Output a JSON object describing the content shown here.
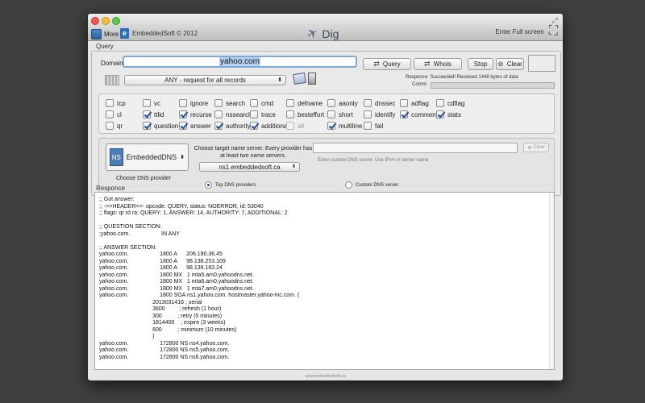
{
  "titlebar": {
    "more_label": "More",
    "brand_label": "EmbeddedSoft © 2012",
    "app_title": "Dig",
    "fullscreen_label": "Enter Full screen"
  },
  "query": {
    "section_label": "Query",
    "domain_label": "Domain",
    "domain_value": "yahoo.com",
    "query_button": "Query",
    "whois_button": "Whois",
    "stop_button": "Stop",
    "clear_button": "Clear",
    "response_status": "Responce:  Succeeded! Received 1448 bytes of data",
    "comm_label": "Comm:",
    "record_type": "ANY - request for all records"
  },
  "flags": [
    {
      "label": "tcp",
      "checked": false,
      "disabled": false
    },
    {
      "label": "vc",
      "checked": false,
      "disabled": false
    },
    {
      "label": "ignore",
      "checked": false,
      "disabled": false
    },
    {
      "label": "search",
      "checked": false,
      "disabled": false
    },
    {
      "label": "cmd",
      "checked": false,
      "disabled": false
    },
    {
      "label": "defname",
      "checked": false,
      "disabled": false
    },
    {
      "label": "aaonly",
      "checked": false,
      "disabled": false
    },
    {
      "label": "dnssec",
      "checked": false,
      "disabled": false
    },
    {
      "label": "adflag",
      "checked": false,
      "disabled": false
    },
    {
      "label": "cdflag",
      "checked": false,
      "disabled": false
    },
    {
      "label": "cl",
      "checked": false,
      "disabled": false
    },
    {
      "label": "ttlid",
      "checked": true,
      "disabled": false
    },
    {
      "label": "recurse",
      "checked": true,
      "disabled": false
    },
    {
      "label": "nssearch",
      "checked": false,
      "disabled": false
    },
    {
      "label": "trace",
      "checked": false,
      "disabled": false
    },
    {
      "label": "besteffort",
      "checked": false,
      "disabled": false
    },
    {
      "label": "short",
      "checked": false,
      "disabled": false
    },
    {
      "label": "identify",
      "checked": false,
      "disabled": false
    },
    {
      "label": "comments",
      "checked": true,
      "disabled": false
    },
    {
      "label": "stats",
      "checked": true,
      "disabled": false
    },
    {
      "label": "qr",
      "checked": false,
      "disabled": false
    },
    {
      "label": "question",
      "checked": true,
      "disabled": false
    },
    {
      "label": "answer",
      "checked": true,
      "disabled": false
    },
    {
      "label": "authority",
      "checked": true,
      "disabled": false
    },
    {
      "label": "additional",
      "checked": true,
      "disabled": false
    },
    {
      "label": "all",
      "checked": false,
      "disabled": true
    },
    {
      "label": "multiline",
      "checked": true,
      "disabled": false
    },
    {
      "label": "fail",
      "checked": false,
      "disabled": false
    }
  ],
  "dns": {
    "provider_icon_text": "NS",
    "provider_name": "EmbeddedDNS",
    "choose_label": "Choose DNS provider",
    "target_text": "Choose target name server. Every provider has at least two name servers.",
    "ns_value": "ns1.embeddedsoft.ca",
    "top_providers_label": "Top DNS providers",
    "custom_hint": "Enter custom DNS server. Use IPv4 or server name",
    "custom_radio_label": "Custom DNS server",
    "clear_label": "Clear"
  },
  "response": {
    "section_label": "Responce",
    "lines": [
      ";; Got answer:",
      ";; ->>HEADER<<- opcode: QUERY, status: NOERROR, id: 53040",
      ";; flags: qr rd ra; QUERY: 1, ANSWER: 14, AUTHORITY: 7, ADDITIONAL: 2",
      "",
      ";; QUESTION SECTION:",
      ";yahoo.com.                    IN ANY",
      "",
      ";; ANSWER SECTION:",
      "yahoo.com.                    1800 A      206.190.36.45",
      "yahoo.com.                    1800 A      98.138.253.109",
      "yahoo.com.                    1800 A      98.139.183.24",
      "yahoo.com.                    1800 MX   1 mta5.am0.yahoodns.net.",
      "yahoo.com.                    1800 MX   1 mta6.am0.yahoodns.net.",
      "yahoo.com.                    1800 MX   1 mta7.am0.yahoodns.net.",
      "yahoo.com.                    1800 SOA ns1.yahoo.com. hostmaster.yahoo-inc.com. (",
      "                                  2013031416 ; serial",
      "                                  3600         ; refresh (1 hour)",
      "                                  300          ; retry (5 minutes)",
      "                                  1814400    ; expire (3 weeks)",
      "                                  600          ; minimum (10 minutes)",
      "                                  )",
      "yahoo.com.                    172800 NS ns4.yahoo.com.",
      "yahoo.com.                    172800 NS ns5.yahoo.com.",
      "yahoo.com.                    172800 NS ns6.yahoo.com."
    ]
  },
  "footer": "www.embeddedsoft.ca"
}
